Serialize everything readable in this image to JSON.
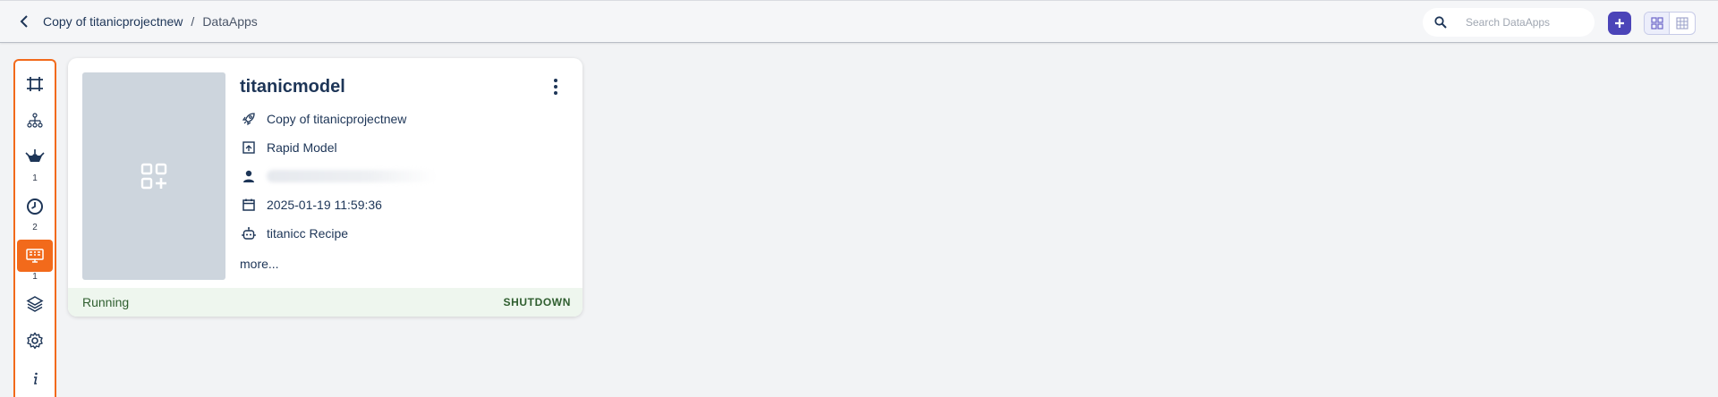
{
  "breadcrumb": {
    "project": "Copy of titanicprojectnew",
    "separator": "/",
    "current": "DataApps"
  },
  "search": {
    "placeholder": "Search DataApps",
    "value": ""
  },
  "colors": {
    "accent": "#4b44b8",
    "sidebar_active": "#f26a1b",
    "text_primary": "#1d3557",
    "status_running_bg": "#eef6ee"
  },
  "sidebar": {
    "items": [
      {
        "icon": "canvas-icon",
        "count": ""
      },
      {
        "icon": "hierarchy-icon",
        "count": ""
      },
      {
        "icon": "prediction-service-icon",
        "count": "1"
      },
      {
        "icon": "clock-icon",
        "count": "2"
      },
      {
        "icon": "dataapps-icon",
        "count": "1",
        "active": true
      },
      {
        "icon": "layers-icon",
        "count": ""
      },
      {
        "icon": "gear-icon",
        "count": ""
      },
      {
        "icon": "info-icon",
        "count": ""
      }
    ]
  },
  "card": {
    "title": "titanicmodel",
    "project": "Copy of titanicprojectnew",
    "model_type": "Rapid Model",
    "created_at": "2025-01-19 11:59:36",
    "recipe": "titanicc Recipe",
    "more": "more...",
    "status": "Running",
    "action": "SHUTDOWN"
  }
}
